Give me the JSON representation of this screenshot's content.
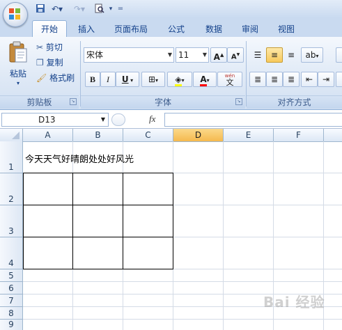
{
  "qat": {
    "save_icon": "save-icon",
    "undo_icon": "undo-icon",
    "redo_icon": "redo-icon",
    "preview_icon": "print-preview-icon"
  },
  "tabs": [
    "开始",
    "插入",
    "页面布局",
    "公式",
    "数据",
    "审阅",
    "视图"
  ],
  "clipboard": {
    "paste": "粘贴",
    "cut": "剪切",
    "copy": "复制",
    "format_painter": "格式刷",
    "group_label": "剪贴板"
  },
  "font": {
    "font_name": "宋体",
    "font_size": "11",
    "grow": "A",
    "shrink": "A",
    "bold": "B",
    "italic": "I",
    "underline": "U",
    "font_color_glyph": "A",
    "phonetic": "wén",
    "phonetic_char": "文",
    "group_label": "字体"
  },
  "alignment": {
    "group_label": "对齐方式"
  },
  "formula_bar": {
    "name_box": "D13",
    "fx": "fx",
    "formula": ""
  },
  "sheet": {
    "columns": [
      "A",
      "B",
      "C",
      "D",
      "E",
      "F"
    ],
    "selected_column": "D",
    "rows": [
      "1",
      "2",
      "3",
      "4",
      "5",
      "6",
      "7",
      "8",
      "9"
    ],
    "cell_a1": "今天天气好晴朗处处好风光"
  },
  "watermark": "Bai 经验",
  "colors": {
    "ribbon_tab_text": "#15428b",
    "highlight_fill": "#ffff00",
    "font_color": "#ff0000",
    "selected_header": "#f5b94e"
  }
}
